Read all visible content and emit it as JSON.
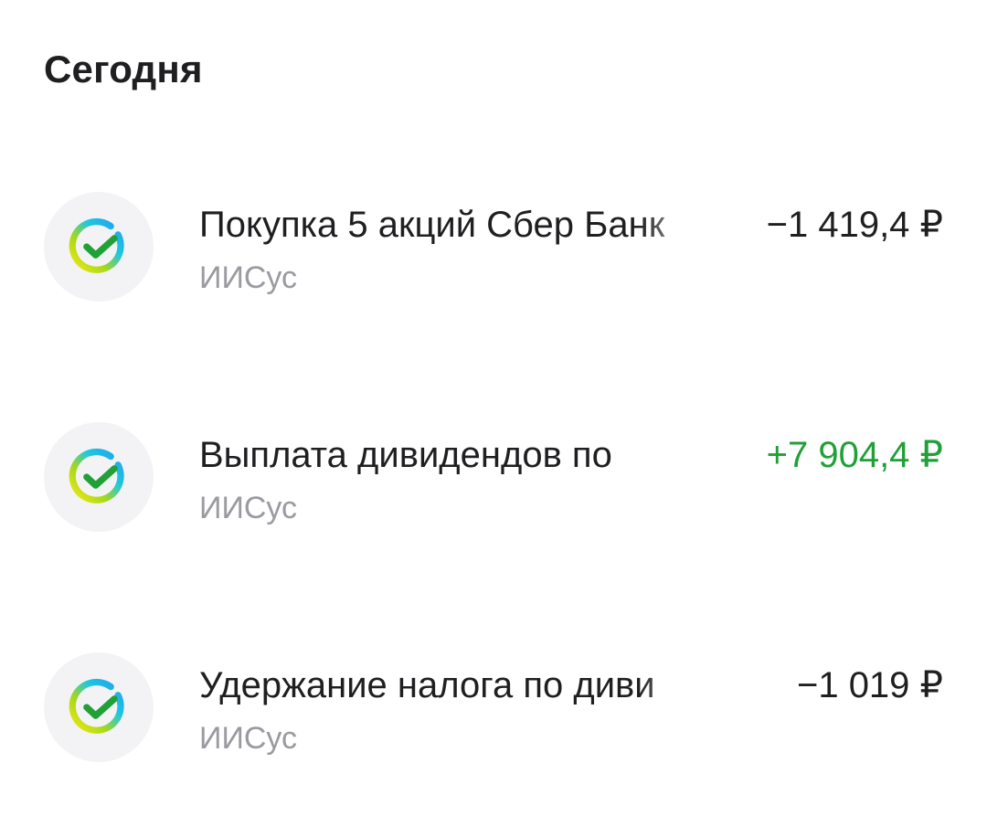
{
  "section": {
    "title": "Сегодня"
  },
  "operations": [
    {
      "title": "Покупка 5 акций Сбер Банк",
      "account": "ИИСус",
      "amount": "−1 419,4 ₽",
      "direction": "debit",
      "icon": "sber-check-icon"
    },
    {
      "title": "Выплата дивидендов по",
      "account": "ИИСус",
      "amount": "+7 904,4 ₽",
      "direction": "credit",
      "icon": "sber-check-icon"
    },
    {
      "title": "Удержание налога по диви",
      "account": "ИИСус",
      "amount": "−1 019 ₽",
      "direction": "debit",
      "icon": "sber-check-icon"
    }
  ],
  "colors": {
    "credit": "#21a038",
    "debit": "#1f1f22",
    "secondary_text": "#9a9aa0",
    "icon_background": "#f3f3f5"
  }
}
